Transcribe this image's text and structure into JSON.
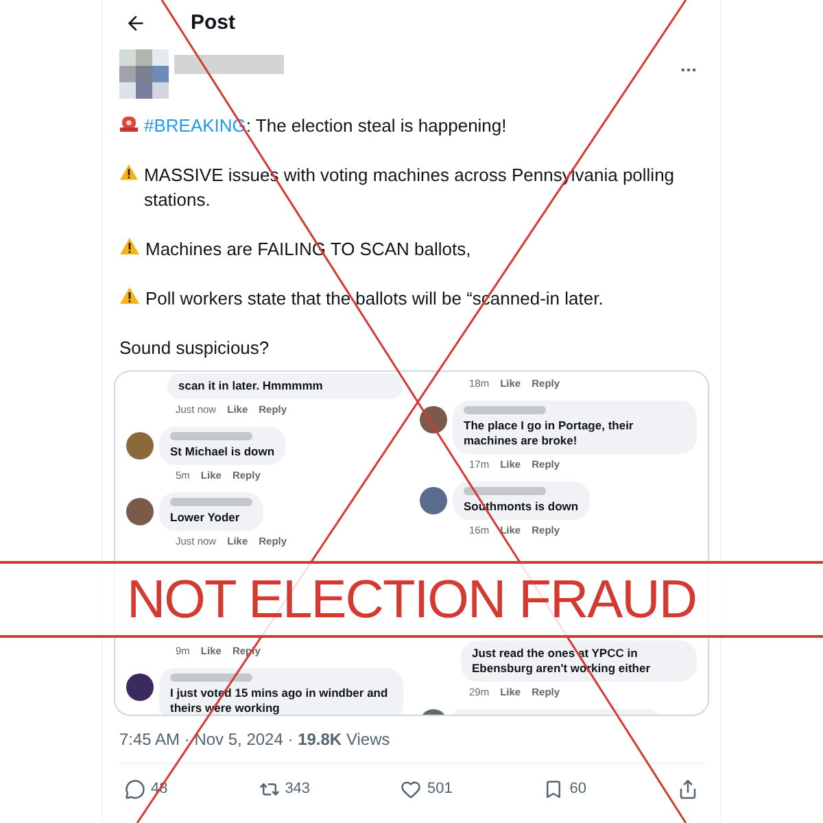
{
  "header": {
    "title": "Post"
  },
  "post": {
    "paragraphs": [
      {
        "kind": "alert",
        "hashtag": "#BREAKING",
        "text": ":  The election steal is happening!"
      },
      {
        "kind": "warning",
        "text": "MASSIVE issues with voting machines across Pennsylvania polling stations."
      },
      {
        "kind": "warning",
        "text": "Machines are FAILING TO SCAN ballots,"
      },
      {
        "kind": "warning",
        "text": "Poll workers state that the ballots will be “scanned-in later."
      },
      {
        "kind": "plain",
        "text": "Sound suspicious?"
      }
    ]
  },
  "screenshot": {
    "top": [
      [
        {
          "kind": "continued",
          "text": "scan it in later.  Hmmmmm"
        },
        {
          "kind": "meta",
          "time": "Just now",
          "like": "Like",
          "reply": "Reply"
        },
        {
          "kind": "comment",
          "text": "St Michael is down"
        },
        {
          "kind": "meta",
          "time": "5m",
          "like": "Like",
          "reply": "Reply"
        },
        {
          "kind": "comment",
          "text": "Lower Yoder"
        },
        {
          "kind": "meta",
          "time": "Just now",
          "like": "Like",
          "reply": "Reply"
        }
      ],
      [
        {
          "kind": "meta",
          "time": "18m",
          "like": "Like",
          "reply": "Reply"
        },
        {
          "kind": "comment",
          "text": "The place I go in Portage, their machines are broke!"
        },
        {
          "kind": "meta",
          "time": "17m",
          "like": "Like",
          "reply": "Reply"
        },
        {
          "kind": "comment",
          "text": "Southmonts is down"
        },
        {
          "kind": "meta",
          "time": "16m",
          "like": "Like",
          "reply": "Reply"
        }
      ]
    ],
    "bottom": [
      [
        {
          "kind": "meta",
          "time": "9m",
          "like": "Like",
          "reply": "Reply"
        },
        {
          "kind": "comment",
          "text": "I just voted 15 mins ago in windber and theirs were working"
        }
      ],
      [
        {
          "kind": "continued",
          "text": "Just read the ones at YPCC in Ebensburg aren't working either"
        },
        {
          "kind": "meta",
          "time": "29m",
          "like": "Like",
          "reply": "Reply"
        },
        {
          "kind": "comment_cut"
        }
      ]
    ]
  },
  "timestamp": "7:45 AM · Nov 5, 2024 · **19.8K** Views",
  "actions": [
    {
      "kind": "reply",
      "count": "48"
    },
    {
      "kind": "repost",
      "count": "343"
    },
    {
      "kind": "like",
      "count": "501"
    },
    {
      "kind": "bookmark",
      "count": "60"
    },
    {
      "kind": "share"
    }
  ],
  "overlay": {
    "stamp": "NOT ELECTION FRAUD"
  }
}
